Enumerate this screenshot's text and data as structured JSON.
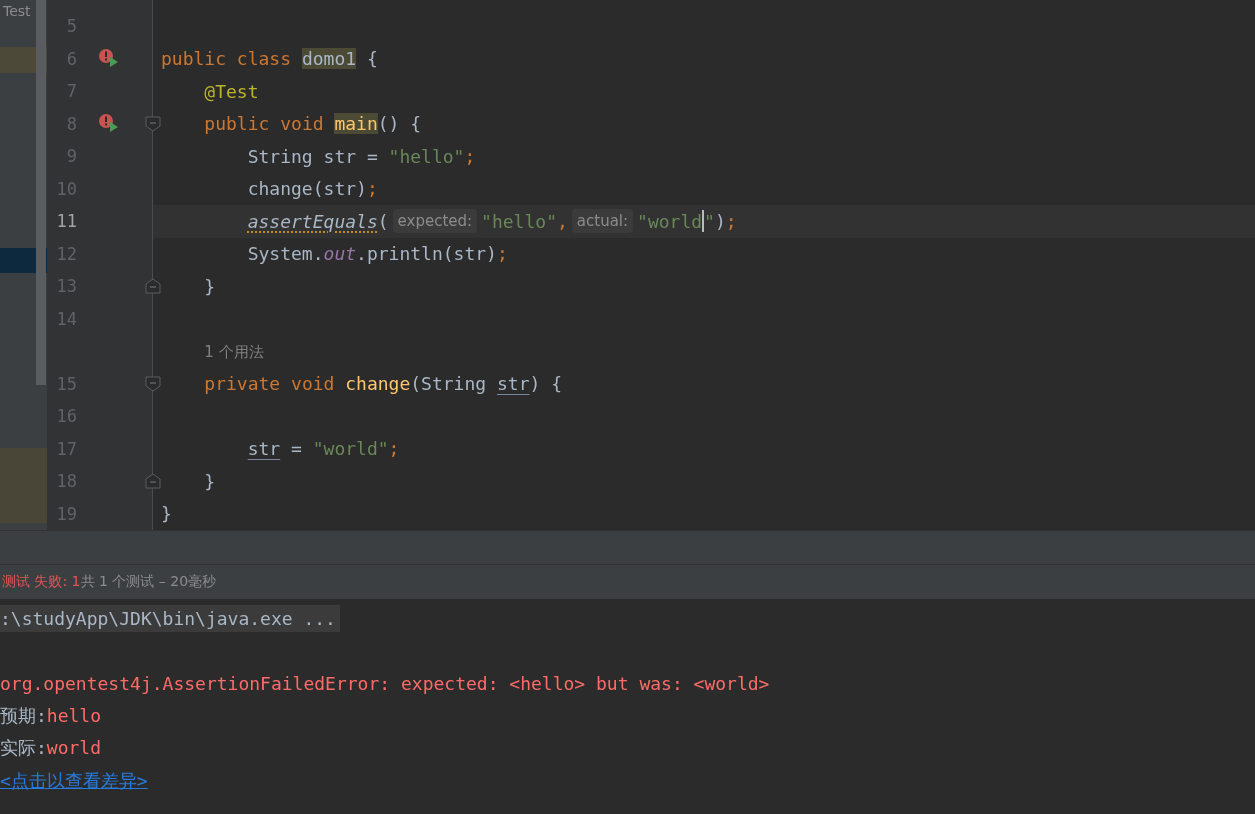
{
  "project_panel": {
    "items": [
      {
        "label": "Test"
      }
    ]
  },
  "editor": {
    "lines": [
      {
        "number": "5"
      },
      {
        "number": "6",
        "run_error": true,
        "tokens": [
          {
            "kind": "keyword",
            "text": "public class "
          },
          {
            "kind": "highlight",
            "text": "domo1"
          },
          {
            "kind": "plain",
            "text": " {"
          }
        ],
        "children": [
          {
            "number": "7",
            "tokens": [
              {
                "kind": "annotation",
                "text": "@Test"
              }
            ]
          },
          {
            "number": "8",
            "run_error": true,
            "fold_start": true,
            "tokens": [
              {
                "kind": "keyword",
                "text": "public void "
              },
              {
                "kind": "method-highlight",
                "text": "main"
              },
              {
                "kind": "plain",
                "text": "() {"
              }
            ],
            "children": [
              {
                "number": "9",
                "tokens": [
                  {
                    "kind": "plain",
                    "text": "String str = "
                  },
                  {
                    "kind": "string",
                    "text": "\"hello\""
                  },
                  {
                    "kind": "punct",
                    "text": ";"
                  }
                ]
              },
              {
                "number": "10",
                "tokens": [
                  {
                    "kind": "plain",
                    "text": "change(str)"
                  },
                  {
                    "kind": "punct",
                    "text": ";"
                  }
                ]
              },
              {
                "number": "11",
                "current": true,
                "tokens": [
                  {
                    "kind": "warning",
                    "text": "assertEquals"
                  },
                  {
                    "kind": "plain",
                    "text": "("
                  },
                  {
                    "kind": "hint",
                    "text": "expected:"
                  },
                  {
                    "kind": "string",
                    "text": "\"hello\""
                  },
                  {
                    "kind": "punct",
                    "text": ","
                  },
                  {
                    "kind": "hint",
                    "text": "actual:"
                  },
                  {
                    "kind": "string",
                    "text": "\"world"
                  },
                  {
                    "kind": "caret"
                  },
                  {
                    "kind": "string",
                    "text": "\""
                  },
                  {
                    "kind": "plain",
                    "text": ")"
                  },
                  {
                    "kind": "punct",
                    "text": ";"
                  }
                ]
              },
              {
                "number": "12",
                "tokens": [
                  {
                    "kind": "plain",
                    "text": "System."
                  },
                  {
                    "kind": "static",
                    "text": "out"
                  },
                  {
                    "kind": "plain",
                    "text": ".println(str)"
                  },
                  {
                    "kind": "punct",
                    "text": ";"
                  }
                ]
              }
            ]
          },
          {
            "number": "13",
            "fold_end": true,
            "tokens": [
              {
                "kind": "plain",
                "text": "}"
              }
            ]
          },
          {
            "number": "14"
          },
          {
            "kind": "usages",
            "tokens": [
              {
                "kind": "usages",
                "text": "1 个用法"
              }
            ]
          },
          {
            "number": "15",
            "fold_start": true,
            "tokens": [
              {
                "kind": "keyword",
                "text": "private void "
              },
              {
                "kind": "method",
                "text": "change"
              },
              {
                "kind": "plain",
                "text": "(String "
              },
              {
                "kind": "param",
                "text": "str"
              },
              {
                "kind": "plain",
                "text": ") {"
              }
            ],
            "children": [
              {
                "number": "16"
              },
              {
                "number": "17",
                "tokens": [
                  {
                    "kind": "param",
                    "text": "str"
                  },
                  {
                    "kind": "plain",
                    "text": " = "
                  },
                  {
                    "kind": "string",
                    "text": "\"world\""
                  },
                  {
                    "kind": "punct",
                    "text": ";"
                  }
                ]
              }
            ]
          },
          {
            "number": "18",
            "fold_end": true,
            "tokens": [
              {
                "kind": "plain",
                "text": "}"
              }
            ]
          }
        ]
      },
      {
        "number": "19",
        "tokens": [
          {
            "kind": "plain",
            "text": "}"
          }
        ]
      }
    ]
  },
  "test_status": {
    "failed": "测试 失败: 1",
    "summary": "共 1 个测试 – 20毫秒"
  },
  "console": {
    "lines": [
      {
        "kind": "command",
        "text": ":\\studyApp\\JDK\\bin\\java.exe ..."
      },
      {
        "kind": "blank"
      },
      {
        "kind": "error",
        "text": "org.opentest4j.AssertionFailedError: expected: <hello> but was: <world>"
      },
      {
        "kind": "pair",
        "label": "预期:",
        "value": "hello"
      },
      {
        "kind": "pair",
        "label": "实际:",
        "value": "world"
      },
      {
        "kind": "link",
        "text": "<点击以查看差异>"
      }
    ]
  }
}
